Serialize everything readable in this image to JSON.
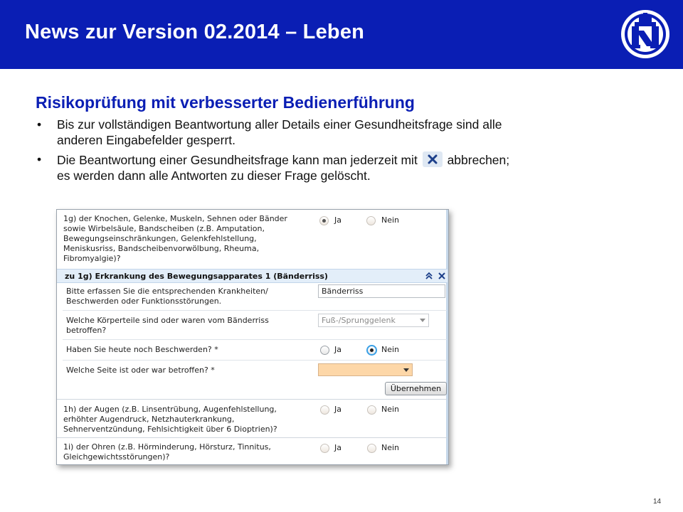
{
  "slide": {
    "title": "News zur Version 02.2014 – Leben",
    "subtitle": "Risikoprüfung mit verbesserter Bedienerführung",
    "bullet_mark": "•",
    "bullet1": [
      "Bis zur vollständigen Beantwortung aller Details einer Gesundheitsfrage sind alle",
      "anderen Eingabefelder gesperrt."
    ],
    "bullet2_before": "Die Beantwortung einer Gesundheitsfrage kann man jederzeit mit",
    "bullet2_after": "abbrechen;",
    "bullet2_line2": "es werden dann alle Antworten zu dieser Frage gelöscht.",
    "page_number": "14"
  },
  "form": {
    "q1g": {
      "lines": [
        "1g) der Knochen, Gelenke, Muskeln, Sehnen oder Bänder",
        "sowie Wirbelsäule, Bandscheiben (z.B. Amputation,",
        "Bewegungseinschränkungen, Gelenkfehlstellung,",
        "Meniskusriss, Bandscheibenvorwölbung, Rheuma,",
        "Fibromyalgie)?"
      ],
      "yes": "Ja",
      "no": "Nein",
      "selected": "Ja"
    },
    "section": {
      "title": "zu 1g) Erkrankung des Bewegungsapparates 1 (Bänderriss)",
      "collapse_icon": "chevrons-up-icon",
      "close_icon": "close-icon"
    },
    "detail1": {
      "lines": [
        "Bitte erfassen Sie die entsprechenden Krankheiten/",
        "Beschwerden oder Funktionsstörungen."
      ],
      "value": "Bänderriss"
    },
    "detail2": {
      "lines": [
        "Welche Körperteile sind oder waren vom Bänderriss",
        "betroffen?"
      ],
      "value": "Fuß-/Sprunggelenk"
    },
    "detail3": {
      "label": "Haben Sie heute noch Beschwerden?  *",
      "yes": "Ja",
      "no": "Nein",
      "selected": "Nein"
    },
    "detail4": {
      "label": "Welche Seite ist oder war betroffen?  *",
      "value": ""
    },
    "apply_button": "Übernehmen",
    "q1h": {
      "lines": [
        "1h) der Augen (z.B. Linsentrübung, Augenfehlstellung,",
        "erhöhter Augendruck, Netzhauterkrankung,",
        "Sehnerventzündung, Fehlsichtigkeit über 6 Dioptrien)?"
      ],
      "yes": "Ja",
      "no": "Nein"
    },
    "q1i": {
      "lines": [
        "1i) der Ohren (z.B. Hörminderung, Hörsturz, Tinnitus,",
        "Gleichgewichtsstörungen)?"
      ],
      "yes": "Ja",
      "no": "Nein"
    }
  },
  "colors": {
    "brand_blue": "#0a1eb4",
    "required_field": "#fdd7a8",
    "section_bg": "#e3eef9"
  }
}
